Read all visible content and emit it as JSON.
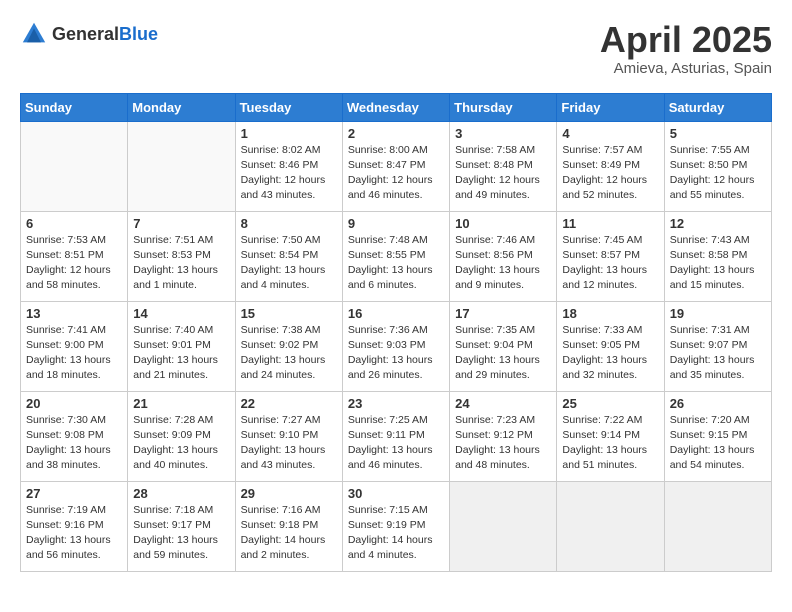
{
  "header": {
    "logo_general": "General",
    "logo_blue": "Blue",
    "month": "April 2025",
    "location": "Amieva, Asturias, Spain"
  },
  "days_of_week": [
    "Sunday",
    "Monday",
    "Tuesday",
    "Wednesday",
    "Thursday",
    "Friday",
    "Saturday"
  ],
  "weeks": [
    [
      {
        "day": "",
        "info": ""
      },
      {
        "day": "",
        "info": ""
      },
      {
        "day": "1",
        "info": "Sunrise: 8:02 AM\nSunset: 8:46 PM\nDaylight: 12 hours and 43 minutes."
      },
      {
        "day": "2",
        "info": "Sunrise: 8:00 AM\nSunset: 8:47 PM\nDaylight: 12 hours and 46 minutes."
      },
      {
        "day": "3",
        "info": "Sunrise: 7:58 AM\nSunset: 8:48 PM\nDaylight: 12 hours and 49 minutes."
      },
      {
        "day": "4",
        "info": "Sunrise: 7:57 AM\nSunset: 8:49 PM\nDaylight: 12 hours and 52 minutes."
      },
      {
        "day": "5",
        "info": "Sunrise: 7:55 AM\nSunset: 8:50 PM\nDaylight: 12 hours and 55 minutes."
      }
    ],
    [
      {
        "day": "6",
        "info": "Sunrise: 7:53 AM\nSunset: 8:51 PM\nDaylight: 12 hours and 58 minutes."
      },
      {
        "day": "7",
        "info": "Sunrise: 7:51 AM\nSunset: 8:53 PM\nDaylight: 13 hours and 1 minute."
      },
      {
        "day": "8",
        "info": "Sunrise: 7:50 AM\nSunset: 8:54 PM\nDaylight: 13 hours and 4 minutes."
      },
      {
        "day": "9",
        "info": "Sunrise: 7:48 AM\nSunset: 8:55 PM\nDaylight: 13 hours and 6 minutes."
      },
      {
        "day": "10",
        "info": "Sunrise: 7:46 AM\nSunset: 8:56 PM\nDaylight: 13 hours and 9 minutes."
      },
      {
        "day": "11",
        "info": "Sunrise: 7:45 AM\nSunset: 8:57 PM\nDaylight: 13 hours and 12 minutes."
      },
      {
        "day": "12",
        "info": "Sunrise: 7:43 AM\nSunset: 8:58 PM\nDaylight: 13 hours and 15 minutes."
      }
    ],
    [
      {
        "day": "13",
        "info": "Sunrise: 7:41 AM\nSunset: 9:00 PM\nDaylight: 13 hours and 18 minutes."
      },
      {
        "day": "14",
        "info": "Sunrise: 7:40 AM\nSunset: 9:01 PM\nDaylight: 13 hours and 21 minutes."
      },
      {
        "day": "15",
        "info": "Sunrise: 7:38 AM\nSunset: 9:02 PM\nDaylight: 13 hours and 24 minutes."
      },
      {
        "day": "16",
        "info": "Sunrise: 7:36 AM\nSunset: 9:03 PM\nDaylight: 13 hours and 26 minutes."
      },
      {
        "day": "17",
        "info": "Sunrise: 7:35 AM\nSunset: 9:04 PM\nDaylight: 13 hours and 29 minutes."
      },
      {
        "day": "18",
        "info": "Sunrise: 7:33 AM\nSunset: 9:05 PM\nDaylight: 13 hours and 32 minutes."
      },
      {
        "day": "19",
        "info": "Sunrise: 7:31 AM\nSunset: 9:07 PM\nDaylight: 13 hours and 35 minutes."
      }
    ],
    [
      {
        "day": "20",
        "info": "Sunrise: 7:30 AM\nSunset: 9:08 PM\nDaylight: 13 hours and 38 minutes."
      },
      {
        "day": "21",
        "info": "Sunrise: 7:28 AM\nSunset: 9:09 PM\nDaylight: 13 hours and 40 minutes."
      },
      {
        "day": "22",
        "info": "Sunrise: 7:27 AM\nSunset: 9:10 PM\nDaylight: 13 hours and 43 minutes."
      },
      {
        "day": "23",
        "info": "Sunrise: 7:25 AM\nSunset: 9:11 PM\nDaylight: 13 hours and 46 minutes."
      },
      {
        "day": "24",
        "info": "Sunrise: 7:23 AM\nSunset: 9:12 PM\nDaylight: 13 hours and 48 minutes."
      },
      {
        "day": "25",
        "info": "Sunrise: 7:22 AM\nSunset: 9:14 PM\nDaylight: 13 hours and 51 minutes."
      },
      {
        "day": "26",
        "info": "Sunrise: 7:20 AM\nSunset: 9:15 PM\nDaylight: 13 hours and 54 minutes."
      }
    ],
    [
      {
        "day": "27",
        "info": "Sunrise: 7:19 AM\nSunset: 9:16 PM\nDaylight: 13 hours and 56 minutes."
      },
      {
        "day": "28",
        "info": "Sunrise: 7:18 AM\nSunset: 9:17 PM\nDaylight: 13 hours and 59 minutes."
      },
      {
        "day": "29",
        "info": "Sunrise: 7:16 AM\nSunset: 9:18 PM\nDaylight: 14 hours and 2 minutes."
      },
      {
        "day": "30",
        "info": "Sunrise: 7:15 AM\nSunset: 9:19 PM\nDaylight: 14 hours and 4 minutes."
      },
      {
        "day": "",
        "info": ""
      },
      {
        "day": "",
        "info": ""
      },
      {
        "day": "",
        "info": ""
      }
    ]
  ]
}
